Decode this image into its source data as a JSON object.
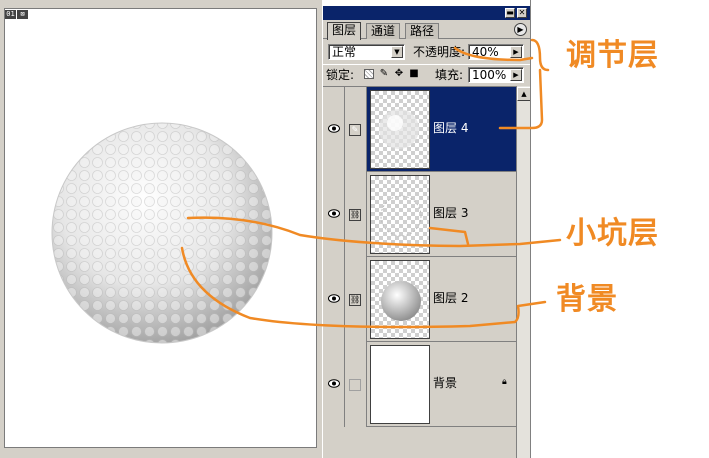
{
  "document": {
    "tab_index": "01",
    "tab_close": "⊠"
  },
  "panel": {
    "tabs": [
      {
        "label": "图层"
      },
      {
        "label": "通道"
      },
      {
        "label": "路径"
      }
    ],
    "menu_icon": "▶",
    "blend_mode": "正常",
    "opacity_label": "不透明度:",
    "opacity_value": "40%",
    "lock_label": "锁定:",
    "fill_label": "填充:",
    "fill_value": "100%",
    "layers": [
      {
        "name": "图层 4",
        "selected": true
      },
      {
        "name": "图层 3",
        "selected": false
      },
      {
        "name": "图层 2",
        "selected": false
      },
      {
        "name": "背景",
        "selected": false,
        "locked": true
      }
    ]
  },
  "annotations": {
    "adjustment_layer": "调节层",
    "dimple_layer": "小坑层",
    "background": "背景"
  },
  "colors": {
    "selected_row": "#0a246a",
    "annotation": "#f08a24",
    "panel_bg": "#d4d0c8"
  }
}
